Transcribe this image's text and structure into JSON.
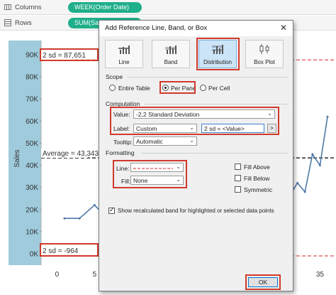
{
  "shelves": {
    "columns": {
      "label": "Columns",
      "pill": "WEEK(Order Date)"
    },
    "rows": {
      "label": "Rows",
      "pill": "SUM(Sales)"
    }
  },
  "chart": {
    "y_axis_title": "Sales",
    "y_ticks": [
      "90K",
      "80K",
      "70K",
      "60K",
      "50K",
      "40K",
      "30K",
      "20K",
      "10K",
      "0K"
    ],
    "x_ticks": [
      "0",
      "5",
      "35"
    ],
    "annotations": {
      "upper": "2 sd = 87,651",
      "average": "Average = 43,343",
      "lower": "2 sd = -964"
    },
    "colors": {
      "line": "#4e79a7",
      "band_dash": "#d62728",
      "avg_dash": "#000000",
      "pane": "#9fcbdc"
    }
  },
  "chart_data": {
    "type": "line",
    "title": "",
    "xlabel": "",
    "ylabel": "Sales",
    "ylim": [
      -3000,
      97000
    ],
    "x": [
      1,
      3,
      5,
      7,
      8,
      9,
      10,
      11,
      12,
      28,
      29,
      30,
      31,
      32,
      33,
      34,
      35,
      36
    ],
    "series": [
      {
        "values": [
          16000,
          16000,
          22000,
          15000,
          25000,
          20000,
          28000,
          29000,
          33000,
          36000,
          29000,
          27500,
          26500,
          32000,
          28000,
          45000,
          40000,
          62000
        ]
      }
    ],
    "reference_lines": [
      {
        "label": "2 sd = 87,651",
        "value": 87651
      },
      {
        "label": "Average = 43,343",
        "value": 43343
      },
      {
        "label": "2 sd = -964",
        "value": -964
      }
    ]
  },
  "dialog": {
    "title": "Add Reference Line, Band, or Box",
    "close": "✕",
    "types": [
      "Line",
      "Band",
      "Distribution",
      "Box Plot"
    ],
    "selected_type": "Distribution",
    "scope": {
      "title": "Scope",
      "options": [
        "Entire Table",
        "Per Pane",
        "Per Cell"
      ],
      "selected": "Per Pane"
    },
    "computation": {
      "title": "Computation",
      "value_label": "Value:",
      "value": "-2,2 Standard Deviation",
      "label_label": "Label:",
      "label_value": "Custom",
      "label_text": "2 sd = <Value>",
      "label_btn": ">",
      "tooltip_label": "Tooltip:",
      "tooltip_value": "Automatic"
    },
    "formatting": {
      "title": "Formatting",
      "line_label": "Line:",
      "fill_label": "Fill:",
      "fill_value": "None",
      "fill_above": "Fill Above",
      "fill_below": "Fill Below",
      "symmetric": "Symmetric"
    },
    "recalc": "Show recalculated band for highlighted or selected data points",
    "ok": "OK"
  }
}
